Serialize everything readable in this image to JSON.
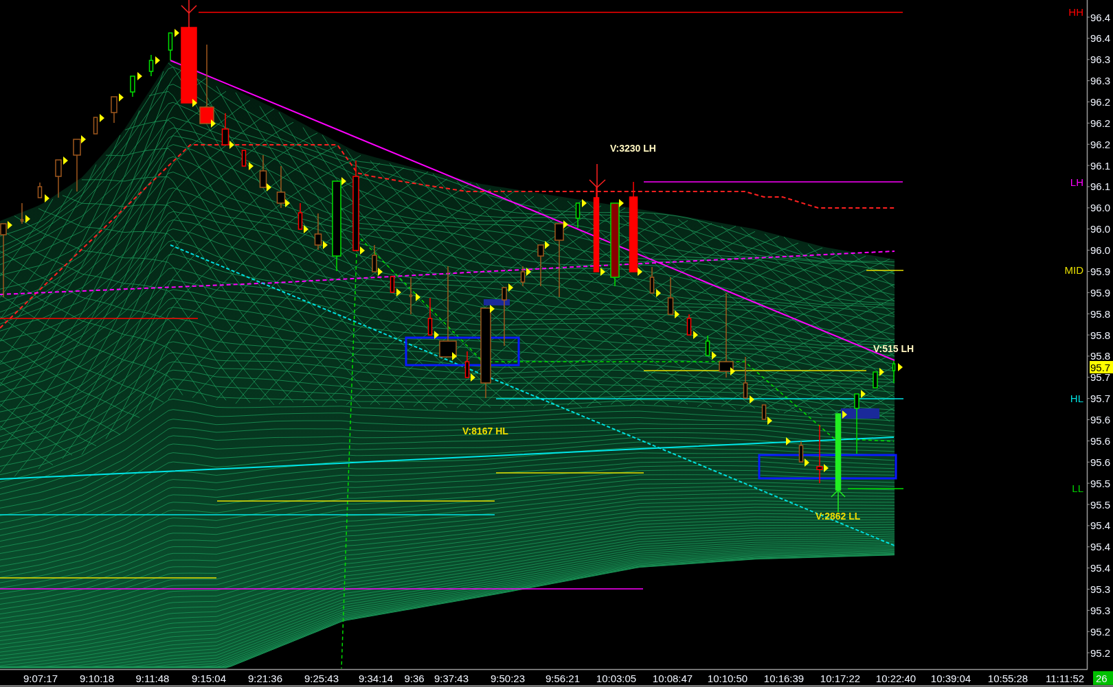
{
  "chart": {
    "level_labels": [
      {
        "text": "HH",
        "color": "#ff0000"
      },
      {
        "text": "LH",
        "color": "#ff00ff"
      },
      {
        "text": "MID",
        "color": "#e8e000"
      },
      {
        "text": "HL",
        "color": "#00e0e0"
      },
      {
        "text": "LL",
        "color": "#00d000"
      }
    ],
    "annotations": [
      {
        "text": "V:3230 LH",
        "color": "#fff6c0"
      },
      {
        "text": "V:8167 HL",
        "color": "#f0dc00"
      },
      {
        "text": "V:515 LH",
        "color": "#fff6c0"
      },
      {
        "text": "V:2862 LL",
        "color": "#f0dc00"
      }
    ]
  },
  "price_axis": {
    "ticks": [
      "96.4",
      "96.4",
      "96.3",
      "96.3",
      "96.2",
      "96.2",
      "96.2",
      "96.1",
      "96.1",
      "96.0",
      "96.0",
      "96.0",
      "95.9",
      "95.9",
      "95.8",
      "95.8",
      "95.8",
      "95.7",
      "95.7",
      "95.6",
      "95.6",
      "95.6",
      "95.5",
      "95.5",
      "95.4",
      "95.4",
      "95.4",
      "95.3",
      "95.3",
      "95.2",
      "95.2"
    ],
    "current_price": "95.7"
  },
  "time_axis": {
    "ticks": [
      "9:07:17",
      "9:10:18",
      "9:11:48",
      "9:15:04",
      "9:21:36",
      "9:25:43",
      "9:34:14",
      "9:36",
      "9:37:43",
      "9:50:23",
      "9:56:21",
      "10:03:05",
      "10:08:47",
      "10:10:50",
      "10:16:39",
      "10:17:22",
      "10:22:40",
      "10:39:04",
      "10:55:28",
      "11:11:52"
    ]
  },
  "status_badge": "26"
}
